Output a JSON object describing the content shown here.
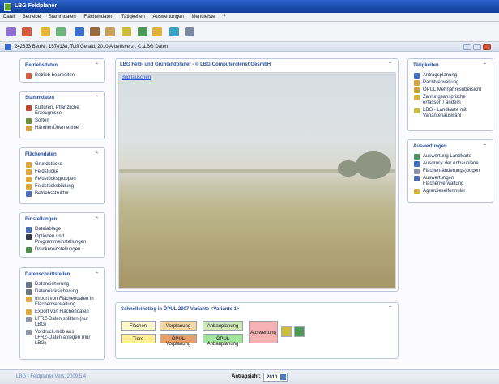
{
  "window": {
    "title": "LBG Feldplaner"
  },
  "menu": [
    "Datei",
    "Betriebe",
    "Stammdaten",
    "Flächendaten",
    "Tätigkeiten",
    "Auswertungen",
    "Menüleiste",
    "?"
  ],
  "infobar": {
    "text": "242633  BetrNr. 1578138, Tolfl Gerald, 2010  Arbeitsverz.: C:\\LBG Daten"
  },
  "panels": {
    "betriebsdaten": {
      "title": "Betriebsdaten",
      "items": [
        [
          "Betrieb bearbeiten"
        ]
      ]
    },
    "stammdaten": {
      "title": "Stammdaten",
      "items": [
        [
          "Kulturen, Pflanzliche",
          "Erzeugnisse"
        ],
        [
          "Sorten"
        ],
        [
          "Händler/Übernehmer"
        ]
      ]
    },
    "flaechendaten": {
      "title": "Flächendaten",
      "items": [
        [
          "Grundstücke"
        ],
        [
          "Feldstücke"
        ],
        [
          "Feldstücksgruppen"
        ],
        [
          "Feldstücksbildung"
        ],
        [
          "Betriebsstruktur"
        ]
      ]
    },
    "einstellungen": {
      "title": "Einstellungen",
      "items": [
        [
          "Dateiablage"
        ],
        [
          "Optionen und",
          "Programmeinstellungen"
        ],
        [
          "Druckereinstellungen"
        ]
      ]
    },
    "datenschnittstellen": {
      "title": "Datenschnittstellen",
      "items": [
        [
          "Datensicherung"
        ],
        [
          "Datenrücksicherung"
        ],
        [
          "Import von Flächendaten in",
          "Flächenverwaltung"
        ],
        [
          "Export von Flächendaten"
        ],
        [
          "LFRZ-Daten splitten (nur",
          "LBG)"
        ],
        [
          "Vordruck.mdb aus",
          "LFRZ-Daten anlegen (nur",
          "LBG)"
        ]
      ]
    },
    "taetigkeiten": {
      "title": "Tätigkeiten",
      "items": [
        [
          "Antragsplanung"
        ],
        [
          "Pachtverwaltung"
        ],
        [
          "ÖPUL Mehrjahresübersicht"
        ],
        [
          "Zahlungsansprüche",
          "erfassen / ändern"
        ],
        [
          "LBG - Landkarte mit",
          "Variantenauswahl"
        ]
      ]
    },
    "auswertungen": {
      "title": "Auswertungen",
      "items": [
        [
          "Auswertung Landkarte"
        ],
        [
          "Ausdruck der Anbaupläne"
        ],
        [
          "Flächen(änderungs)bogen"
        ],
        [
          "Auswertungen",
          "Flächenverwaltung"
        ],
        [
          "Agrardieselformular"
        ]
      ]
    }
  },
  "center": {
    "title": "LBG Feld- und Grünlandplaner - © LBG-Computerdienst GesmbH",
    "swap_link": "Bild tauschen"
  },
  "quick": {
    "title": "Schnelleinstieg in ÖPUL 2007 Variante <Variante 1>",
    "buttons": {
      "flaechen": "Flächen",
      "vorplanung": "Vorplanung",
      "anbauplanung": "Anbauplanung",
      "tiere": "Tiere",
      "oepul_vor": "ÖPUL Vorplanung",
      "oepul_anbau": "ÖPUL Anbauplanung",
      "auswertung": "Auswertung"
    }
  },
  "status": {
    "version": "LBG - Feldplaner Vers. 2009.5.4",
    "year_label": "Antragsjahr:",
    "year_value": "2010"
  }
}
